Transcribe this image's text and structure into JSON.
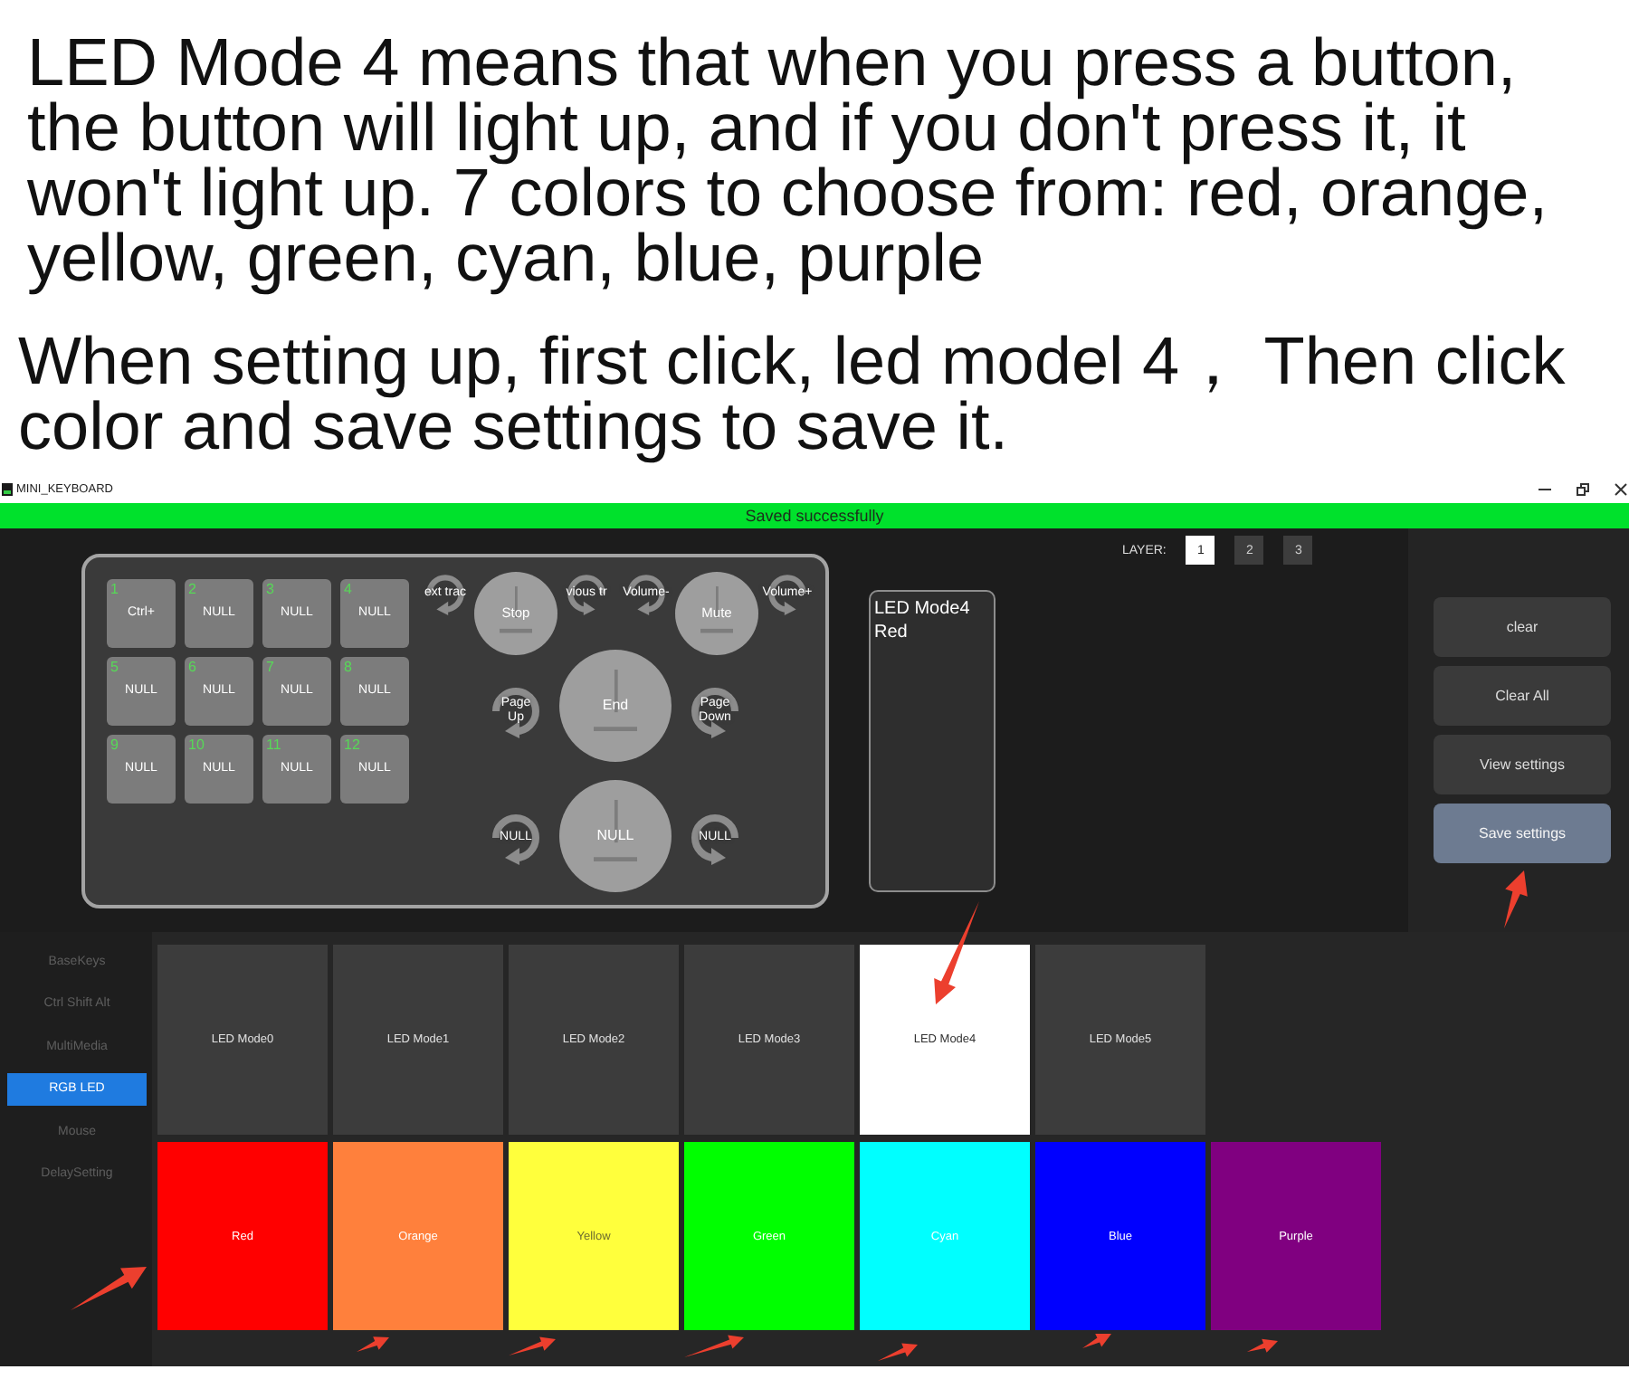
{
  "intro": {
    "paragraphs": [
      "LED Mode 4 means that when you press a button,\nthe button will light up, and if you don't press it, it\nwon't light up. 7 colors to choose from: red, orange,\nyellow, green, cyan, blue, purple",
      "When setting up, first click, led model 4， Then click\ncolor and save settings to save it."
    ]
  },
  "window": {
    "title": "MINI_KEYBOARD"
  },
  "status_bar": {
    "message": "Saved successfully"
  },
  "layers": {
    "label": "LAYER:",
    "items": [
      {
        "label": "1",
        "selected": true
      },
      {
        "label": "2",
        "selected": false
      },
      {
        "label": "3",
        "selected": false
      }
    ]
  },
  "keys": [
    {
      "number": "1",
      "label": "Ctrl+"
    },
    {
      "number": "2",
      "label": "NULL"
    },
    {
      "number": "3",
      "label": "NULL"
    },
    {
      "number": "4",
      "label": "NULL"
    },
    {
      "number": "5",
      "label": "NULL"
    },
    {
      "number": "6",
      "label": "NULL"
    },
    {
      "number": "7",
      "label": "NULL"
    },
    {
      "number": "8",
      "label": "NULL"
    },
    {
      "number": "9",
      "label": "NULL"
    },
    {
      "number": "10",
      "label": "NULL"
    },
    {
      "number": "11",
      "label": "NULL"
    },
    {
      "number": "12",
      "label": "NULL"
    }
  ],
  "knobs": [
    {
      "press": "Stop",
      "rotate_left": "ext trac",
      "rotate_right": "vious tr"
    },
    {
      "press": "Mute",
      "rotate_left": "Volume-",
      "rotate_right": "Volume+"
    },
    {
      "press": "End",
      "rotate_left": "Page Up",
      "rotate_right": "Page Down"
    },
    {
      "press": "NULL",
      "rotate_left": "NULL",
      "rotate_right": "NULL"
    }
  ],
  "info_box": {
    "lines": [
      "LED Mode4",
      "Red"
    ]
  },
  "actions": [
    {
      "label": "clear",
      "highlighted": false
    },
    {
      "label": "Clear All",
      "highlighted": false
    },
    {
      "label": "View settings",
      "highlighted": false
    },
    {
      "label": "Save settings",
      "highlighted": true
    }
  ],
  "sidebar": {
    "items": [
      {
        "label": "BaseKeys",
        "selected": false
      },
      {
        "label": "Ctrl Shift Alt",
        "selected": false
      },
      {
        "label": "MultiMedia",
        "selected": false
      },
      {
        "label": "RGB LED",
        "selected": true
      },
      {
        "label": "Mouse",
        "selected": false
      },
      {
        "label": "DelaySetting",
        "selected": false
      }
    ]
  },
  "led_modes": [
    {
      "label": "LED Mode0",
      "selected": false
    },
    {
      "label": "LED Mode1",
      "selected": false
    },
    {
      "label": "LED Mode2",
      "selected": false
    },
    {
      "label": "LED Mode3",
      "selected": false
    },
    {
      "label": "LED Mode4",
      "selected": true
    },
    {
      "label": "LED Mode5",
      "selected": false
    }
  ],
  "colors": [
    {
      "label": "Red",
      "color": "#ff0000"
    },
    {
      "label": "Orange",
      "color": "#ff803c"
    },
    {
      "label": "Yellow",
      "color": "#ffff3c"
    },
    {
      "label": "Green",
      "color": "#00ff00"
    },
    {
      "label": "Cyan",
      "color": "#00ffff"
    },
    {
      "label": "Blue",
      "color": "#0000ff"
    },
    {
      "label": "Purple",
      "color": "#800080"
    }
  ]
}
